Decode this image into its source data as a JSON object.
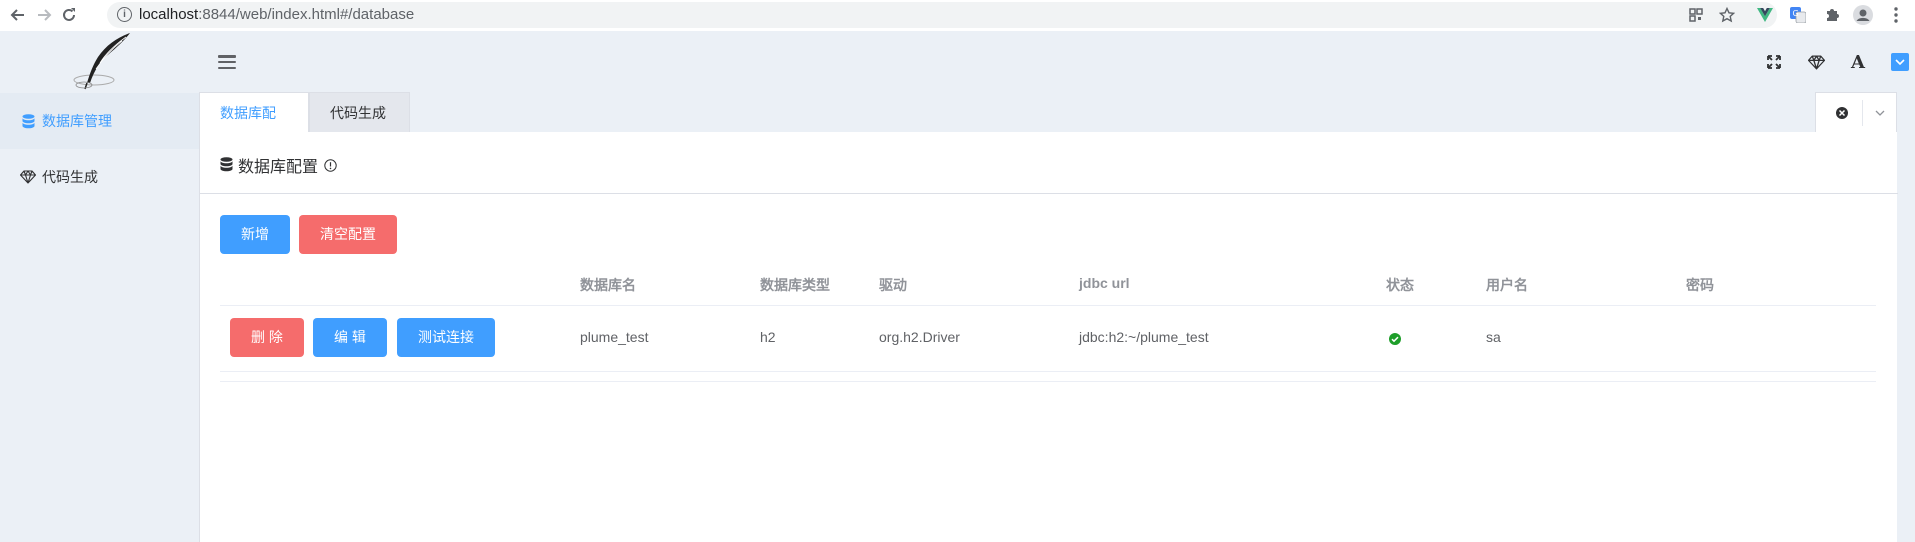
{
  "browser": {
    "url_host": "localhost",
    "url_rest": ":8844/web/index.html#/database"
  },
  "sidebar": {
    "items": [
      {
        "label": "数据库管理",
        "icon": "database-icon",
        "active": true
      },
      {
        "label": "代码生成",
        "icon": "diamond-icon",
        "active": false
      }
    ]
  },
  "topbar": {
    "icons": [
      "fullscreen-icon",
      "diamond-icon",
      "font-size-icon",
      "theme-color-icon"
    ],
    "font_icon_text": "A"
  },
  "tabs": [
    {
      "label": "数据库配置",
      "active": true
    },
    {
      "label": "代码生成",
      "active": false
    }
  ],
  "page": {
    "title": "数据库配置",
    "buttons": {
      "add": "新增",
      "clear": "清空配置"
    }
  },
  "table": {
    "columns": [
      "数据库名",
      "数据库类型",
      "驱动",
      "jdbc url",
      "状态",
      "用户名",
      "密码"
    ],
    "rows": [
      {
        "actions": {
          "delete": "删 除",
          "edit": "编 辑",
          "test": "测试连接"
        },
        "db_name": "plume_test",
        "db_type": "h2",
        "driver": "org.h2.Driver",
        "jdbc_url": "jdbc:h2:~/plume_test",
        "status": "ok",
        "username": "sa",
        "password": ""
      }
    ]
  },
  "colors": {
    "primary": "#409eff",
    "danger": "#f56c6c",
    "success": "#1e9e2a",
    "background": "#ebf0f6"
  }
}
